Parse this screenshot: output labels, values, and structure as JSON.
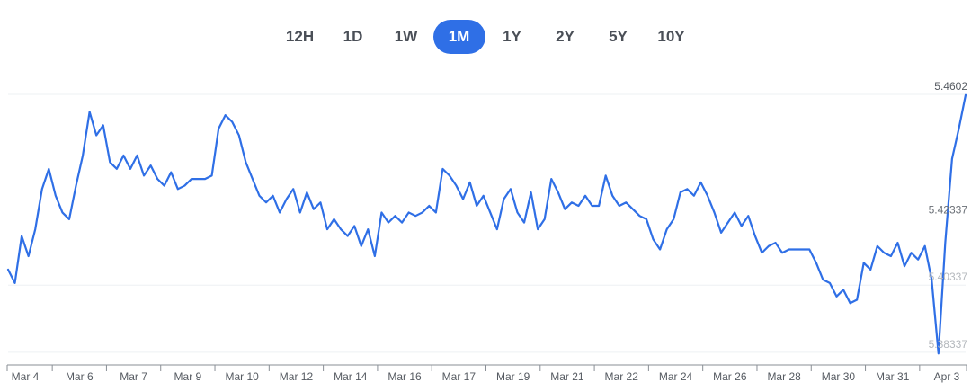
{
  "range_selector": {
    "options": [
      "12H",
      "1D",
      "1W",
      "1M",
      "1Y",
      "2Y",
      "5Y",
      "10Y"
    ],
    "selected": "1M"
  },
  "colors": {
    "line": "#2f6fe6",
    "active_button": "#2f6fe6",
    "axis": "#8a8f96",
    "grid": "#eef0f3"
  },
  "chart_data": {
    "type": "line",
    "title": "",
    "xlabel": "",
    "ylabel": "",
    "x_tick_labels": [
      "Mar 4",
      "Mar 6",
      "Mar 7",
      "Mar 9",
      "Mar 10",
      "Mar 12",
      "Mar 14",
      "Mar 16",
      "Mar 17",
      "Mar 19",
      "Mar 21",
      "Mar 22",
      "Mar 24",
      "Mar 26",
      "Mar 28",
      "Mar 30",
      "Mar 31",
      "Apr 3"
    ],
    "y_tick_labels": [
      "5.4602",
      "5.42337",
      "5.40337",
      "5.38337"
    ],
    "ylim": [
      5.3812,
      5.4602
    ],
    "grid": true,
    "legend": "none",
    "series": [
      {
        "values": [
          5.408,
          5.404,
          5.418,
          5.412,
          5.42,
          5.432,
          5.438,
          5.43,
          5.425,
          5.423,
          5.433,
          5.442,
          5.455,
          5.448,
          5.451,
          5.44,
          5.438,
          5.442,
          5.438,
          5.442,
          5.436,
          5.439,
          5.435,
          5.433,
          5.437,
          5.432,
          5.433,
          5.435,
          5.435,
          5.435,
          5.436,
          5.45,
          5.454,
          5.452,
          5.448,
          5.44,
          5.435,
          5.43,
          5.428,
          5.43,
          5.425,
          5.429,
          5.432,
          5.425,
          5.431,
          5.426,
          5.428,
          5.42,
          5.423,
          5.42,
          5.418,
          5.421,
          5.415,
          5.42,
          5.412,
          5.425,
          5.422,
          5.424,
          5.422,
          5.425,
          5.424,
          5.425,
          5.427,
          5.425,
          5.438,
          5.436,
          5.433,
          5.429,
          5.434,
          5.427,
          5.43,
          5.425,
          5.42,
          5.429,
          5.432,
          5.425,
          5.422,
          5.431,
          5.42,
          5.423,
          5.435,
          5.431,
          5.426,
          5.428,
          5.427,
          5.43,
          5.427,
          5.427,
          5.436,
          5.43,
          5.427,
          5.428,
          5.426,
          5.424,
          5.423,
          5.417,
          5.414,
          5.42,
          5.423,
          5.431,
          5.432,
          5.43,
          5.434,
          5.43,
          5.425,
          5.419,
          5.422,
          5.425,
          5.421,
          5.424,
          5.418,
          5.413,
          5.415,
          5.416,
          5.413,
          5.414,
          5.414,
          5.414,
          5.414,
          5.41,
          5.405,
          5.404,
          5.4,
          5.402,
          5.398,
          5.399,
          5.41,
          5.408,
          5.415,
          5.413,
          5.412,
          5.416,
          5.409,
          5.413,
          5.411,
          5.415,
          5.405,
          5.383,
          5.416,
          5.441,
          5.45,
          5.46
        ]
      }
    ]
  }
}
